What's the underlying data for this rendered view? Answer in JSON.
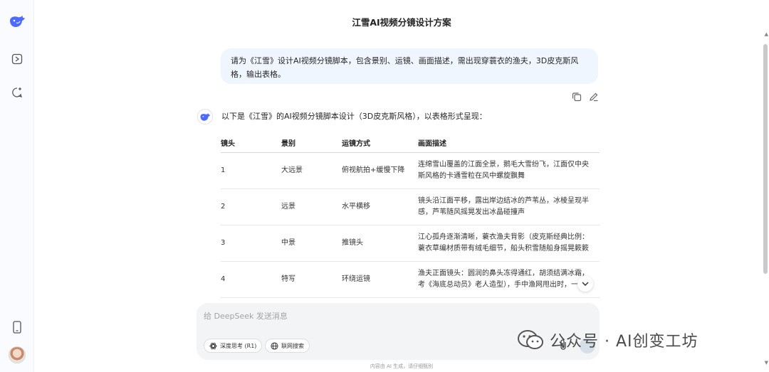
{
  "window": {
    "title": "江雪AI视频分镜设计方案"
  },
  "sidebar": {
    "icons": [
      "deepseek-logo",
      "toggle-sidebar-icon",
      "new-chat-icon",
      "mobile-app-icon",
      "user-avatar"
    ]
  },
  "conversation": {
    "user_message": "请为《江雪》设计AI视频分镜脚本，包含景别、运镜、画面描述，需出现穿蓑衣的渔夫，3D皮克斯风格，输出表格。",
    "ai_intro": "以下是《江雪》的AI视频分镜脚本设计（3D皮克斯风格），以表格形式呈现：",
    "table": {
      "headers": [
        "镜头",
        "景别",
        "运镜方式",
        "画面描述"
      ],
      "rows": [
        {
          "shot": "1",
          "scale": "大远景",
          "move": "俯视航拍+缓慢下降",
          "desc1": "连绵雪山覆盖的江面全景，鹅毛大雪纷飞，江面仅中央",
          "desc2": "斯风格的卡通雪粒在风中螺旋飘舞"
        },
        {
          "shot": "2",
          "scale": "远景",
          "move": "水平横移",
          "desc1": "镜头沿江面平移，露出岸边结冰的芦苇丛，冰棱呈现半",
          "desc2": "感，芦苇随风摇晃发出冰晶碰撞声"
        },
        {
          "shot": "3",
          "scale": "中景",
          "move": "推镜头",
          "desc1": "江心孤舟逐渐清晰，蓑衣渔夫背影（皮克斯经典比例：",
          "desc2": "蓑衣草编材质带有绒毛细节，船头积雪随船身摇晃簌簌"
        },
        {
          "shot": "4",
          "scale": "特写",
          "move": "环绕运镜",
          "desc1": "渔夫正面镜头：圆润的鼻头冻得通红，胡须结满冰霜，",
          "desc2": "考《海底总动员》老人造型），手中渔网甩出时，一"
        }
      ]
    }
  },
  "composer": {
    "placeholder": "给 DeepSeek 发送消息",
    "think_label": "深度思考 (R1)",
    "search_label": "联网搜索"
  },
  "footer": {
    "text": "内容由 AI 生成，请仔细甄别"
  },
  "watermark": {
    "text": "公众号 · AI创变工坊"
  },
  "colors": {
    "accent": "#4d6bfe",
    "bubble": "#eff6ff",
    "composer": "#f3f4f6"
  }
}
